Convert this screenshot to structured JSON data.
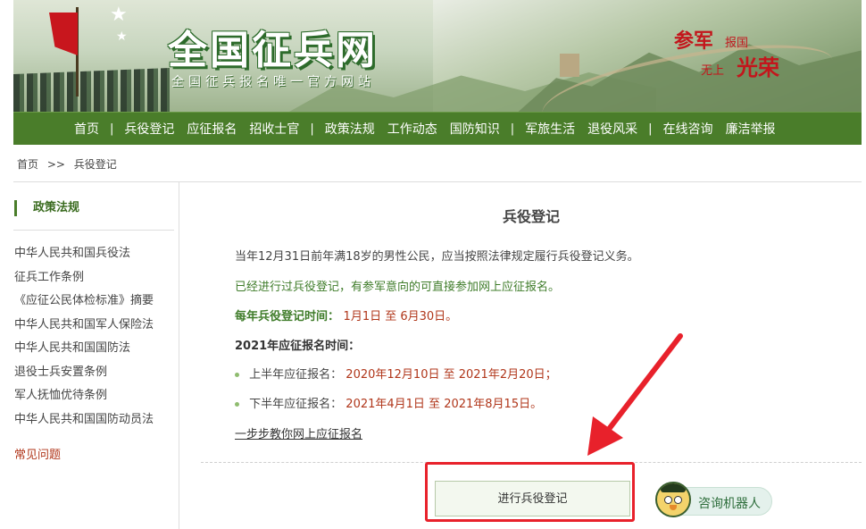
{
  "header": {
    "site_title": "全国征兵网",
    "slogan": "全国征兵报名唯一官方网站",
    "seal_1": "参军",
    "seal_2": "报国",
    "seal_3": "无上",
    "seal_4": "光荣"
  },
  "nav": {
    "items": [
      "首页",
      "兵役登记",
      "应征报名",
      "招收士官",
      "政策法规",
      "工作动态",
      "国防知识",
      "军旅生活",
      "退役风采",
      "在线咨询",
      "廉洁举报"
    ],
    "separator": "|"
  },
  "breadcrumb": {
    "home": "首页",
    "separator": ">>",
    "current": "兵役登记"
  },
  "sidebar": {
    "title": "政策法规",
    "items": [
      "中华人民共和国兵役法",
      "征兵工作条例",
      "《应征公民体检标准》摘要",
      "中华人民共和国军人保险法",
      "中华人民共和国国防法",
      "退役士兵安置条例",
      "军人抚恤优待条例",
      "中华人民共和国国防动员法"
    ],
    "faq": "常见问题"
  },
  "main": {
    "title": "兵役登记",
    "intro": "当年12月31日前年满18岁的男性公民，应当按照法律规定履行兵役登记义务。",
    "online_note": "已经进行过兵役登记，有参军意向的可直接参加网上应征报名。",
    "annual_label": "每年兵役登记时间：",
    "annual_value": "1月1日 至 6月30日。",
    "year_label": "2021年应征报名时间：",
    "h1_label": "上半年应征报名：",
    "h1_value": "2020年12月10日 至 2021年2月20日；",
    "h2_label": "下半年应征报名：",
    "h2_value": "2021年4月1日 至 2021年8月15日。",
    "guide_link": "一步步教你网上应征报名",
    "register_button": "进行兵役登记",
    "robot_button": "咨询机器人"
  },
  "colors": {
    "nav_green": "#4a7d2a",
    "accent_red": "#e8212b",
    "value_red": "#b0361a",
    "text_green": "#3f7c2a"
  }
}
